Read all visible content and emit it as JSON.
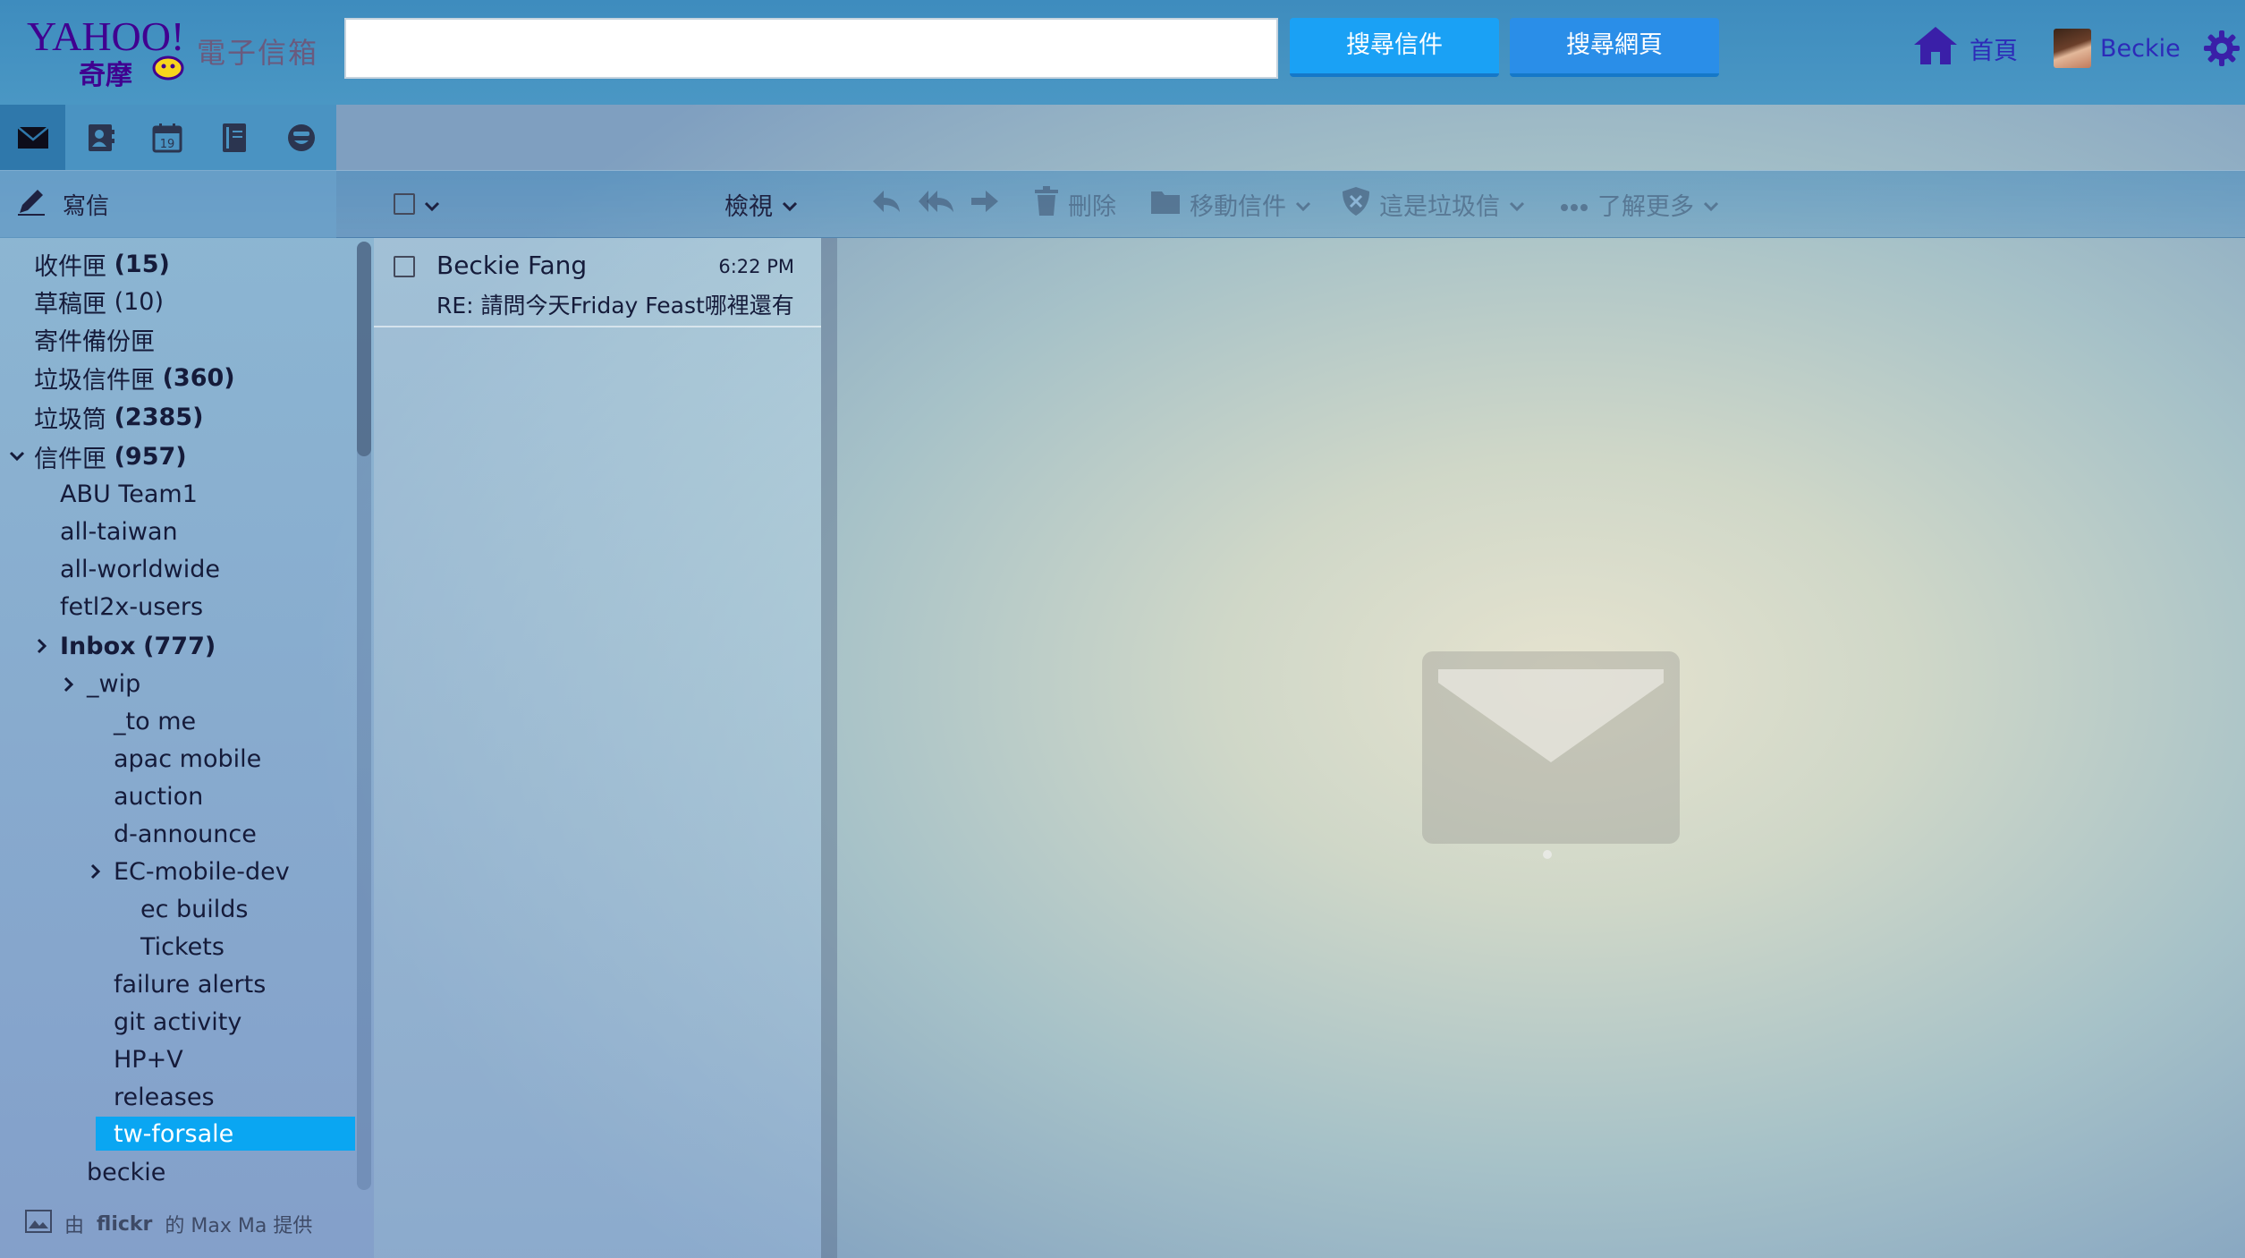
{
  "header": {
    "logo_text": "YAHOO!",
    "logo_sub": "奇摩",
    "product_name": "電子信箱",
    "search": {
      "value": "",
      "placeholder": ""
    },
    "search_mail_label": "搜尋信件",
    "search_web_label": "搜尋網頁",
    "home_label": "首頁",
    "user_name": "Beckie"
  },
  "apps": [
    "mail-icon",
    "contacts-icon",
    "calendar-icon",
    "notepad-icon",
    "messenger-icon"
  ],
  "calendar_day": "19",
  "toolbar": {
    "compose_label": "寫信",
    "view_label": "檢視",
    "delete_label": "刪除",
    "move_label": "移動信件",
    "spam_label": "這是垃圾信",
    "more_label": "了解更多"
  },
  "folders": {
    "inbox": {
      "name": "收件匣",
      "count": "(15)"
    },
    "drafts": {
      "name": "草稿匣",
      "count": "(10)"
    },
    "sent": {
      "name": "寄件備份匣",
      "count": ""
    },
    "spam": {
      "name": "垃圾信件匣",
      "count": "(360)"
    },
    "trash": {
      "name": "垃圾筒",
      "count": "(2385)"
    },
    "folders_root": {
      "name": "信件匣",
      "count": "(957)"
    },
    "abu": "ABU Team1",
    "all_taiwan": "all-taiwan",
    "all_worldwide": "all-worldwide",
    "fetl2x": "fetl2x-users",
    "inbox_sub": {
      "name": "Inbox",
      "count": "(777)"
    },
    "wip": "_wip",
    "to_me": "_to me",
    "apac": "apac mobile",
    "auction": "auction",
    "d_announce": "d-announce",
    "ec_mobile": "EC-mobile-dev",
    "ec_builds": "ec builds",
    "tickets": "Tickets",
    "failure": "failure alerts",
    "git": "git activity",
    "hpv": "HP+V",
    "releases": "releases",
    "tw_forsale": "tw-forsale",
    "beckie": "beckie"
  },
  "photo_credit": {
    "prefix": "由",
    "brand": "flickr",
    "suffix": "的 Max Ma 提供"
  },
  "messages": [
    {
      "sender": "Beckie Fang",
      "time": "6:22 PM",
      "subject": "RE: 請問今天Friday Feast哪裡還有"
    }
  ],
  "colors": {
    "accent": "#1aa1f5",
    "selected_folder": "#0aa6f2",
    "link": "#2d2ab8",
    "brand_purple": "#400090"
  }
}
